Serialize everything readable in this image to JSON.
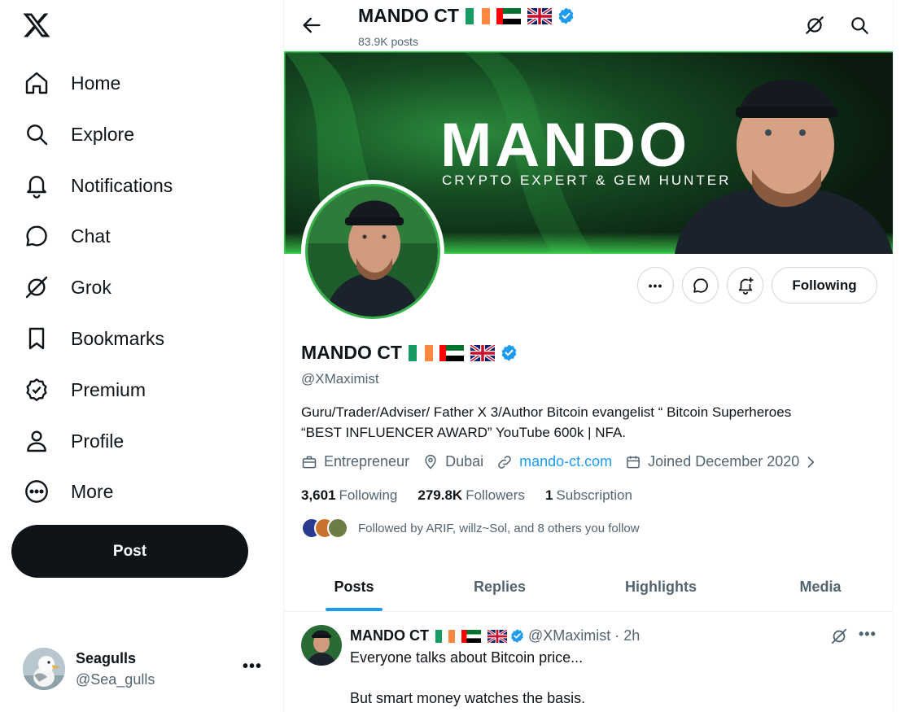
{
  "sidebar": {
    "nav": [
      {
        "label": "Home",
        "icon": "home-icon"
      },
      {
        "label": "Explore",
        "icon": "search-icon"
      },
      {
        "label": "Notifications",
        "icon": "bell-icon"
      },
      {
        "label": "Chat",
        "icon": "chat-icon"
      },
      {
        "label": "Grok",
        "icon": "grok-icon"
      },
      {
        "label": "Bookmarks",
        "icon": "bookmark-icon"
      },
      {
        "label": "Premium",
        "icon": "verified-badge-icon"
      },
      {
        "label": "Profile",
        "icon": "person-icon"
      },
      {
        "label": "More",
        "icon": "more-circle-icon"
      }
    ],
    "post_label": "Post",
    "account": {
      "name": "Seagulls",
      "handle": "@Sea_gulls"
    }
  },
  "header": {
    "title": "MANDO CT",
    "posts_count": "83.9K posts"
  },
  "banner": {
    "title": "MANDO",
    "subtitle": "CRYPTO EXPERT & GEM HUNTER"
  },
  "profile": {
    "name": "MANDO CT",
    "handle": "@XMaximist",
    "bio_line1": "Guru/Trader/Adviser/ Father X 3/Author Bitcoin evangelist “ Bitcoin Superheroes",
    "bio_line2": "“BEST INFLUENCER AWARD” YouTube 600k | NFA.",
    "profession": "Entrepreneur",
    "location": "Dubai",
    "website": "mando-ct.com",
    "joined": "Joined December 2020",
    "following_button": "Following",
    "stats": {
      "following_count": "3,601",
      "following_label": "Following",
      "followers_count": "279.8K",
      "followers_label": "Followers",
      "subscription_count": "1",
      "subscription_label": "Subscription"
    },
    "followed_by": "Followed by ARIF, willz~Sol, and 8 others you follow"
  },
  "tabs": [
    "Posts",
    "Replies",
    "Highlights",
    "Media"
  ],
  "active_tab": "Posts",
  "tweet": {
    "name": "MANDO CT",
    "handle_time": "@XMaximist · 2h",
    "line1": "Everyone talks about Bitcoin price...",
    "line2": "But smart money watches the basis."
  },
  "colors": {
    "accent": "#1d9bf0",
    "text": "#0f1419",
    "muted": "#536471",
    "banner_green": "#36b24a"
  }
}
